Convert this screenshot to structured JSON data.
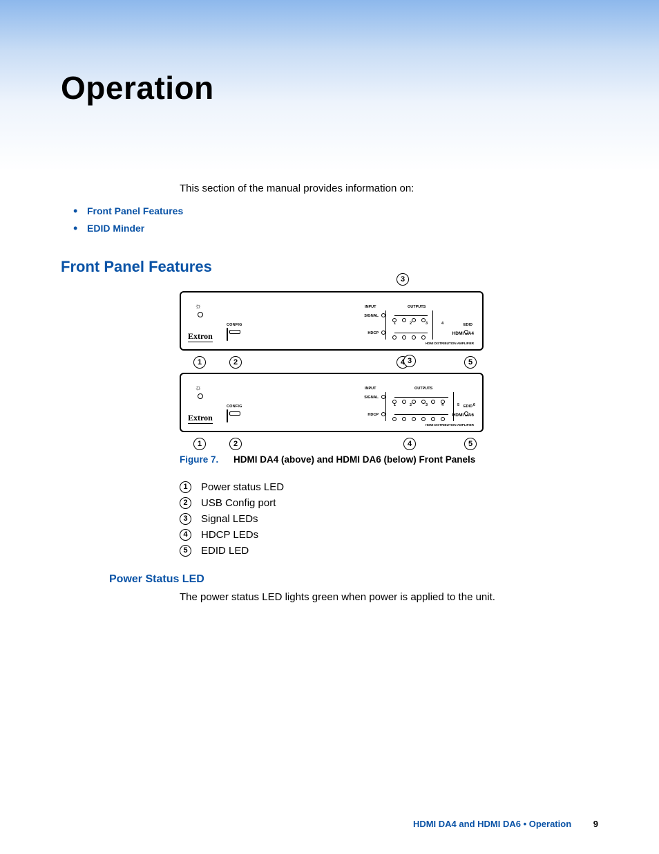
{
  "title": "Operation",
  "intro": "This section of the manual provides information on:",
  "toc": {
    "item1": "Front Panel Features",
    "item2": "EDID Minder"
  },
  "section_front_panel": "Front Panel Features",
  "panel_common": {
    "brand": "Extron",
    "config_label": "CONFIG",
    "input_label": "INPUT",
    "outputs_label": "OUTPUTS",
    "signal_label": "SIGNAL",
    "hdcp_label": "HDCP",
    "edid_label": "EDID",
    "subtitle": "HDMI DISTRIBUTION AMPLIFIER"
  },
  "panel_da4": {
    "model": "HDMI DA4",
    "output_count": 4,
    "numbers": "1 2 3 4"
  },
  "panel_da6": {
    "model": "HDMI DA6",
    "output_count": 6,
    "numbers": "1 2 3 4 5 6"
  },
  "callouts": {
    "c1": "1",
    "c2": "2",
    "c3": "3",
    "c4": "4",
    "c5": "5"
  },
  "figure": {
    "label": "Figure 7.",
    "caption": "HDMI DA4 (above) and HDMI DA6 (below) Front Panels"
  },
  "legend": {
    "l1": "Power status LED",
    "l2": "USB Config port",
    "l3": "Signal LEDs",
    "l4": "HDCP LEDs",
    "l5": "EDID LED"
  },
  "subsection_power": "Power Status LED",
  "power_para": "The power status LED lights green when power is applied to the unit.",
  "footer": {
    "text": "HDMI DA4 and HDMI DA6 • Operation",
    "page": "9"
  }
}
